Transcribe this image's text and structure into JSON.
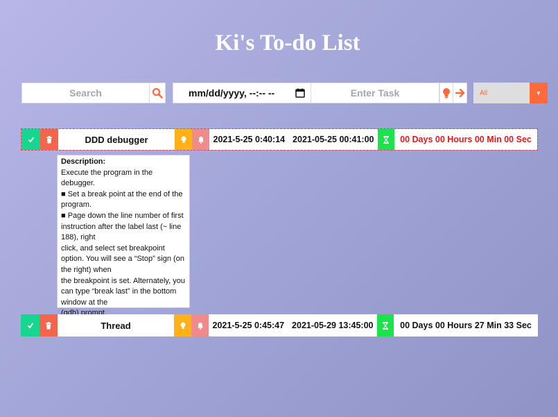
{
  "title": "Ki's To-do List",
  "toolbar": {
    "search_placeholder": "Search",
    "date_placeholder": "mm/dd/yyyy, --:-- --",
    "task_placeholder": "Enter Task",
    "filter_value": "All"
  },
  "icons": {
    "search": "search-icon",
    "calendar": "calendar-icon",
    "bulb": "lightbulb-icon",
    "arrow": "arrow-right-icon",
    "check": "check-icon",
    "trash": "trash-icon",
    "bell": "bell-icon",
    "hourglass": "hourglass-icon"
  },
  "colors": {
    "accent": "#ff6a3d",
    "check": "#17d68f",
    "trash": "#f4664b",
    "bulb": "#ffb11a",
    "bell": "#f08b8b",
    "timer": "#1ae34c",
    "overdue_text": "#e21a1a"
  },
  "tasks": [
    {
      "name": "DDD debugger",
      "created": "2021-5-25 0:40:14",
      "due": "2021-05-25 00:41:00",
      "countdown": "00 Days 00 Hours 00 Min 00 Sec",
      "description": {
        "heading": "Description:",
        "lines": [
          "Execute the program in the debugger.",
          "■ Set a break point at the end of the program.",
          "■ Page down the line number of first instruction after the label last (~ line 188), right",
          "click, and select set breakpoint option. You will see a “Stop” sign (on the right) when",
          "the breakpoint is set. Alternately, you can type “break last” in the bottom window at the",
          "(gdb) prompt."
        ]
      }
    },
    {
      "name": "Thread",
      "created": "2021-5-25 0:45:47",
      "due": "2021-05-29 13:45:00",
      "countdown": "00 Days 00 Hours 27 Min 33 Sec"
    }
  ]
}
